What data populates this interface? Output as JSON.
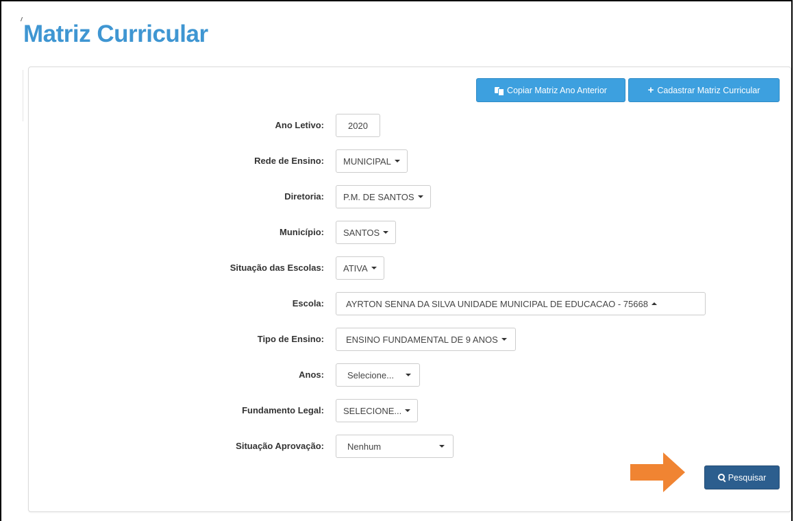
{
  "page": {
    "title": "Matriz Curricular"
  },
  "toolbar": {
    "copy_label": "Copiar Matriz Ano Anterior",
    "add_label": "Cadastrar Matriz Curricular"
  },
  "form": {
    "ano_letivo": {
      "label": "Ano Letivo:",
      "value": "2020"
    },
    "rede_ensino": {
      "label": "Rede de Ensino:",
      "value": "MUNICIPAL"
    },
    "diretoria": {
      "label": "Diretoria:",
      "value": "P.M. DE SANTOS"
    },
    "municipio": {
      "label": "Município:",
      "value": "SANTOS"
    },
    "situacao_escolas": {
      "label": "Situação das Escolas:",
      "value": "ATIVA"
    },
    "escola": {
      "label": "Escola:",
      "value": "AYRTON SENNA DA SILVA UNIDADE MUNICIPAL DE EDUCACAO - 75668"
    },
    "tipo_ensino": {
      "label": "Tipo de Ensino:",
      "value": "ENSINO FUNDAMENTAL DE 9 ANOS"
    },
    "anos": {
      "label": "Anos:",
      "value": "Selecione..."
    },
    "fundamento_legal": {
      "label": "Fundamento Legal:",
      "value": "SELECIONE..."
    },
    "situacao_aprovacao": {
      "label": "Situação Aprovação:",
      "value": "Nenhum"
    }
  },
  "actions": {
    "search_label": "Pesquisar"
  },
  "colors": {
    "title": "#3f96d2",
    "primary_button": "#3da0df",
    "search_button": "#2c5e8e",
    "arrow": "#f08432"
  }
}
